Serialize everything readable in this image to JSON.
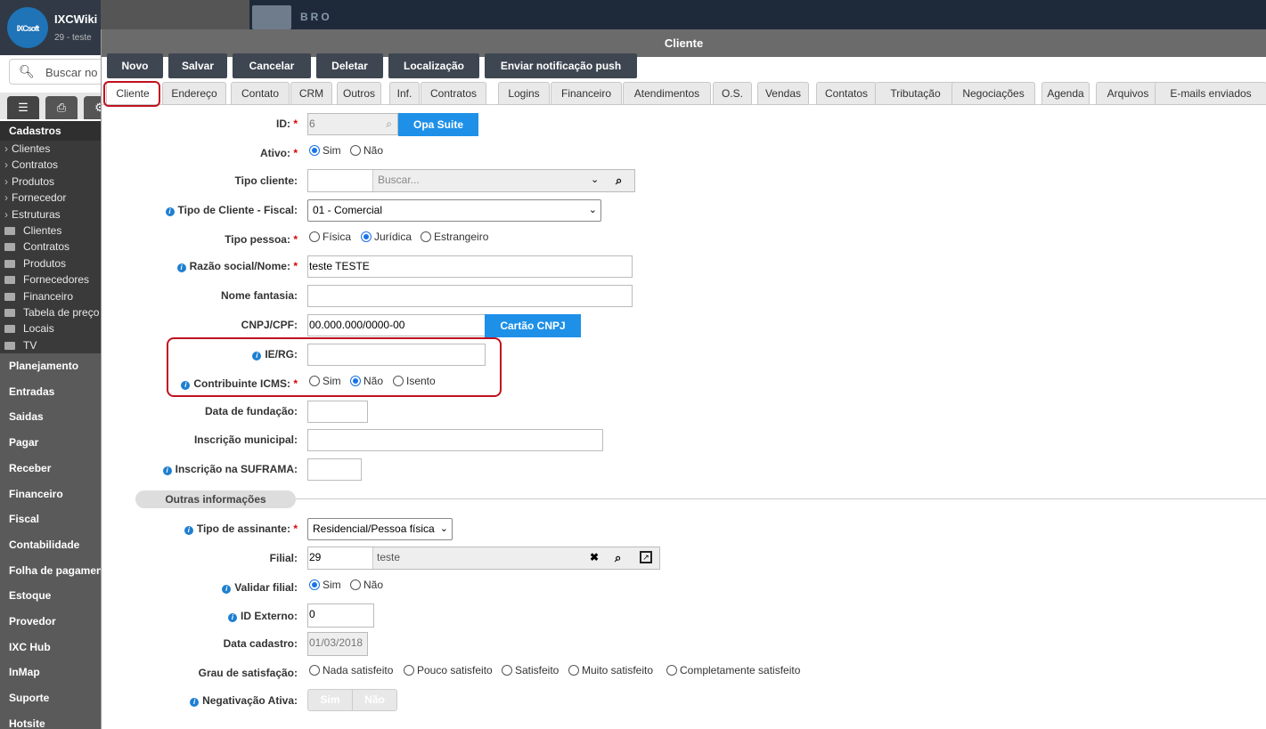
{
  "sidebar": {
    "app_name": "IXCWiki",
    "app_sub": "29 - teste",
    "logo_text": "IXCsoft",
    "search_placeholder": "Buscar no",
    "section_title": "Cadastros",
    "sub_items": [
      "Clientes",
      "Contratos",
      "Produtos",
      "Fornecedor",
      "Estruturas"
    ],
    "folder_items": [
      "Clientes",
      "Contratos",
      "Produtos",
      "Fornecedores",
      "Financeiro",
      "Tabela de preço",
      "Locais",
      "TV"
    ],
    "menu_items": [
      "Planejamento",
      "Entradas",
      "Saidas",
      "Pagar",
      "Receber",
      "Financeiro",
      "Fiscal",
      "Contabilidade",
      "Folha de pagamento",
      "Estoque",
      "Provedor",
      "IXC Hub",
      "InMap",
      "Suporte",
      "Hotsite"
    ]
  },
  "modal": {
    "title": "Cliente",
    "toolbar": [
      "Novo",
      "Salvar",
      "Cancelar",
      "Deletar",
      "Localização",
      "Enviar notificação push"
    ],
    "tabs": [
      "Cliente",
      "Endereço",
      "Contato",
      "CRM",
      "Outros",
      "Inf.",
      "Contratos",
      "Logins",
      "Financeiro",
      "Atendimentos",
      "O.S.",
      "Vendas",
      "Contatos",
      "Tributação",
      "Negociações",
      "Agenda",
      "Arquivos",
      "E-mails enviados"
    ],
    "active_tab": "Cliente"
  },
  "form": {
    "id_label": "ID:",
    "id_value": "6",
    "opa_suite": "Opa Suite",
    "ativo_label": "Ativo:",
    "ativo_options": [
      "Sim",
      "Não"
    ],
    "tipo_cliente_label": "Tipo cliente:",
    "tipo_cliente_placeholder": "Buscar...",
    "tipo_fiscal_label": "Tipo de Cliente - Fiscal:",
    "tipo_fiscal_value": "01 - Comercial",
    "tipo_pessoa_label": "Tipo pessoa:",
    "tipo_pessoa_options": [
      "Física",
      "Jurídica",
      "Estrangeiro"
    ],
    "razao_label": "Razão social/Nome:",
    "razao_value": "teste TESTE",
    "fantasia_label": "Nome fantasia:",
    "cnpj_label": "CNPJ/CPF:",
    "cnpj_value": "00.000.000/0000-00",
    "cartao_cnpj": "Cartão CNPJ",
    "ie_label": "IE/RG:",
    "icms_label": "Contribuinte ICMS:",
    "icms_options": [
      "Sim",
      "Não",
      "Isento"
    ],
    "fundacao_label": "Data de fundação:",
    "municipal_label": "Inscrição municipal:",
    "suframa_label": "Inscrição na SUFRAMA:",
    "outras_info": "Outras informações",
    "assinante_label": "Tipo de assinante:",
    "assinante_value": "Residencial/Pessoa física",
    "filial_label": "Filial:",
    "filial_id": "29",
    "filial_name": "teste",
    "validar_label": "Validar filial:",
    "validar_options": [
      "Sim",
      "Não"
    ],
    "id_externo_label": "ID Externo:",
    "id_externo_value": "0",
    "data_cadastro_label": "Data cadastro:",
    "data_cadastro_value": "01/03/2018",
    "grau_label": "Grau de satisfação:",
    "grau_options": [
      "Nada satisfeito",
      "Pouco satisfeito",
      "Satisfeito",
      "Muito satisfeito",
      "Completamente satisfeito"
    ],
    "negativacao_label": "Negativação Ativa:",
    "negativacao_options": [
      "Sim",
      "Não"
    ]
  },
  "background_title": "BRO"
}
